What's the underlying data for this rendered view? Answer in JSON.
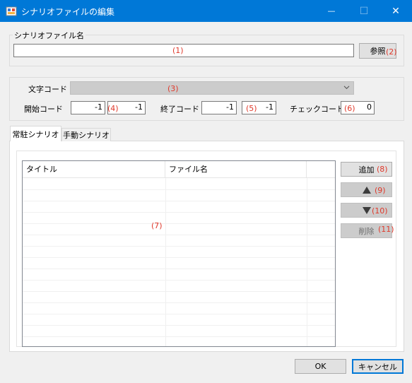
{
  "window": {
    "title": "シナリオファイルの編集",
    "minimize_glyph": "—",
    "maximize_glyph": "☐",
    "close_glyph": "✕"
  },
  "file_group": {
    "label": "シナリオファイル名",
    "path_value": "",
    "path_marker": "(1)",
    "browse_label": "参照",
    "browse_marker": "(2)"
  },
  "code_group": {
    "charset_label": "文字コード",
    "charset_marker": "(3)",
    "start_label": "開始コード",
    "start_value1": "-1",
    "start_value2": "-1",
    "start_marker": "(4)",
    "end_label": "終了コード",
    "end_value1": "-1",
    "end_value2": "-1",
    "end_marker": "(5)",
    "check_label": "チェックコード",
    "check_value": "0",
    "check_marker": "(6)"
  },
  "tabs": [
    {
      "label": "常駐シナリオ",
      "active": true
    },
    {
      "label": "手動シナリオ",
      "active": false
    }
  ],
  "list": {
    "columns": [
      "タイトル",
      "ファイル名",
      ""
    ],
    "marker": "(7)",
    "rows": []
  },
  "side_buttons": {
    "add_label": "追加",
    "add_marker": "(8)",
    "up_marker": "(9)",
    "down_marker": "(10)",
    "delete_label": "削除",
    "delete_marker": "(11)"
  },
  "footer": {
    "ok_label": "OK",
    "cancel_label": "キャンセル"
  },
  "colors": {
    "titlebar": "#0078d7",
    "marker": "#e0392b"
  }
}
